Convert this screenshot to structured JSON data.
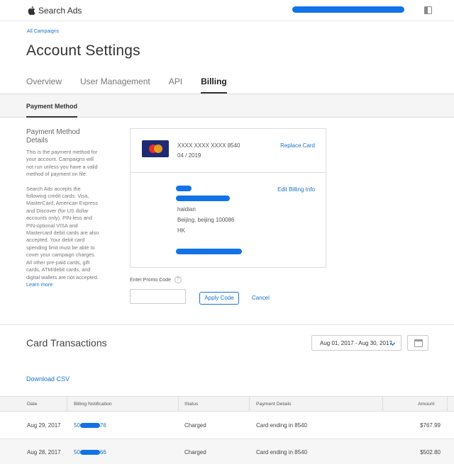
{
  "app": {
    "name": "Search Ads"
  },
  "breadcrumb": "All Campaigns",
  "page_title": "Account Settings",
  "tabs": [
    {
      "label": "Overview"
    },
    {
      "label": "User Management"
    },
    {
      "label": "API"
    },
    {
      "label": "Billing"
    }
  ],
  "subtab": "Payment Method",
  "payment_method": {
    "title": "Payment Method Details",
    "desc_1": "This is the payment method for your account. Campaigns will not run unless you have a valid method of payment on file.",
    "desc_2": "Search Ads accepts the following credit cards: Visa, MasterCard, American Express and Discover (for US dollar accounts only). PIN-less and PIN-optional VISA and Mastercard debit cards are also accepted. Your debit card spending limit must be able to cover your campaign charges. All other pre-paid cards, gift cards, ATM/debit cards, and digital wallets are not accepted.",
    "learn_more": "Learn more",
    "card_brand": "MasterCard",
    "card_number": "XXXX XXXX XXXX 8540",
    "card_expiry": "04 / 2019",
    "replace_label": "Replace Card",
    "edit_label": "Edit Billing Info",
    "address_line_1": "haidian",
    "address_line_2": "Beijing, beijing 100086",
    "address_line_3": "HK"
  },
  "promo": {
    "label": "Enter Promo Code",
    "help_glyph": "?",
    "value": "",
    "apply_label": "Apply Code",
    "cancel_label": "Cancel"
  },
  "transactions": {
    "title": "Card Transactions",
    "date_range": "Aug 01, 2017 - Aug 30, 2017",
    "download_label": "Download CSV",
    "columns": [
      "Date",
      "Billing Notification",
      "Status",
      "Payment Details",
      "Amount"
    ],
    "rows": [
      {
        "date": "Aug 29, 2017",
        "notification_prefix": "50",
        "notification_suffix": "76",
        "status": "Charged",
        "details": "Card ending in 8540",
        "amount": "$767.99"
      },
      {
        "date": "Aug 28, 2017",
        "notification_prefix": "50",
        "notification_suffix": "66",
        "status": "Charged",
        "details": "Card ending in 8540",
        "amount": "$502.80"
      }
    ]
  },
  "colors": {
    "link": "#1a73c9",
    "redaction": "#1273e6"
  }
}
